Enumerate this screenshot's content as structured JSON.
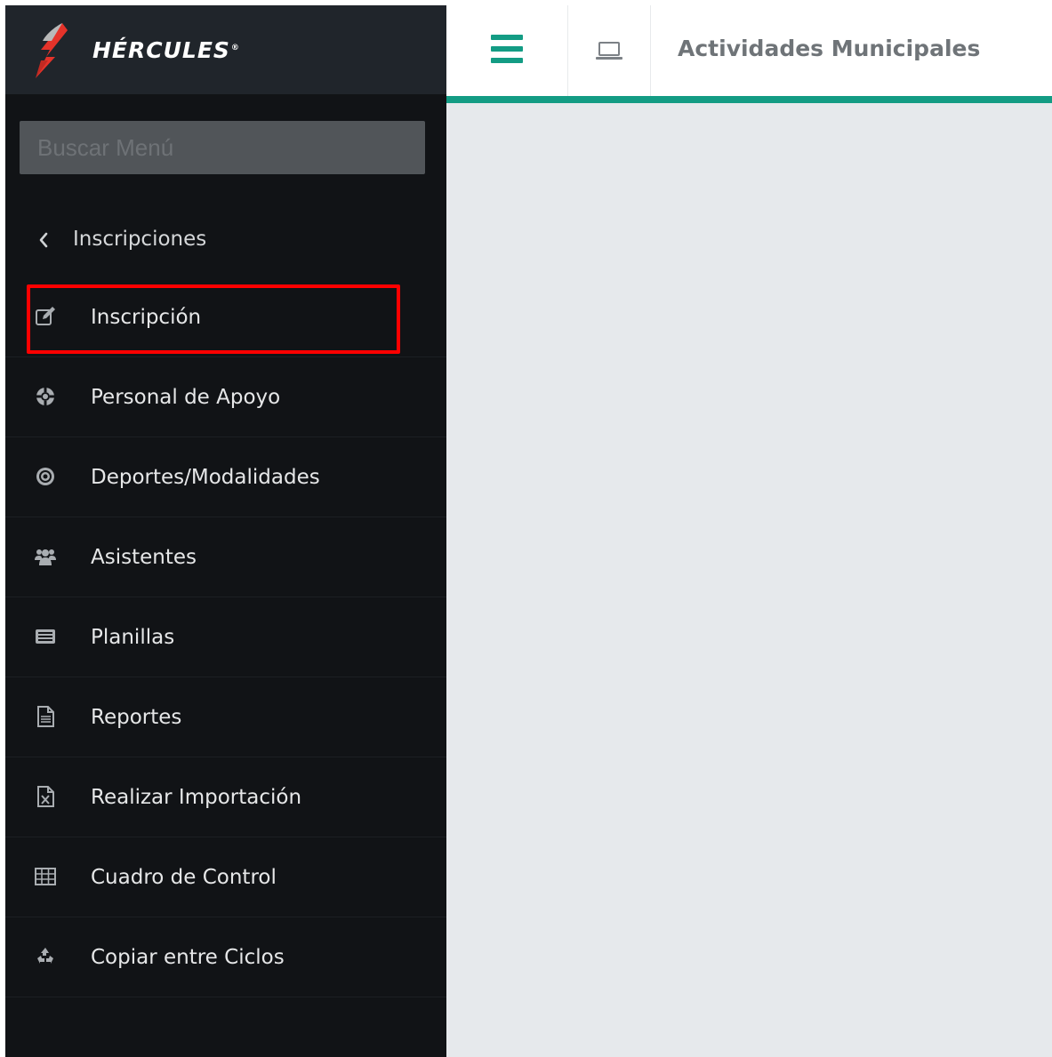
{
  "brand": {
    "name": "HÉRCULES",
    "reg": "®",
    "accent": "#e5332a"
  },
  "search": {
    "placeholder": "Buscar Menú",
    "value": ""
  },
  "breadcrumb": {
    "label": "Inscripciones"
  },
  "menu": {
    "items": [
      {
        "label": "Inscripción",
        "icon": "edit-icon"
      },
      {
        "label": "Personal de Apoyo",
        "icon": "life-ring-icon"
      },
      {
        "label": "Deportes/Modalidades",
        "icon": "target-icon"
      },
      {
        "label": "Asistentes",
        "icon": "users-icon"
      },
      {
        "label": "Planillas",
        "icon": "list-alt-icon"
      },
      {
        "label": "Reportes",
        "icon": "file-text-icon"
      },
      {
        "label": "Realizar Importación",
        "icon": "file-excel-icon"
      },
      {
        "label": "Cuadro de Control",
        "icon": "table-icon"
      },
      {
        "label": "Copiar entre Ciclos",
        "icon": "recycle-icon"
      }
    ],
    "highlighted": "Inscripción"
  },
  "topbar": {
    "title": "Actividades Municipales"
  },
  "colors": {
    "sidebar_bg": "#111316",
    "brand_bg": "#20252b",
    "accent_teal": "#139c84",
    "content_bg": "#e6e9ec",
    "highlight": "#ff0000"
  }
}
